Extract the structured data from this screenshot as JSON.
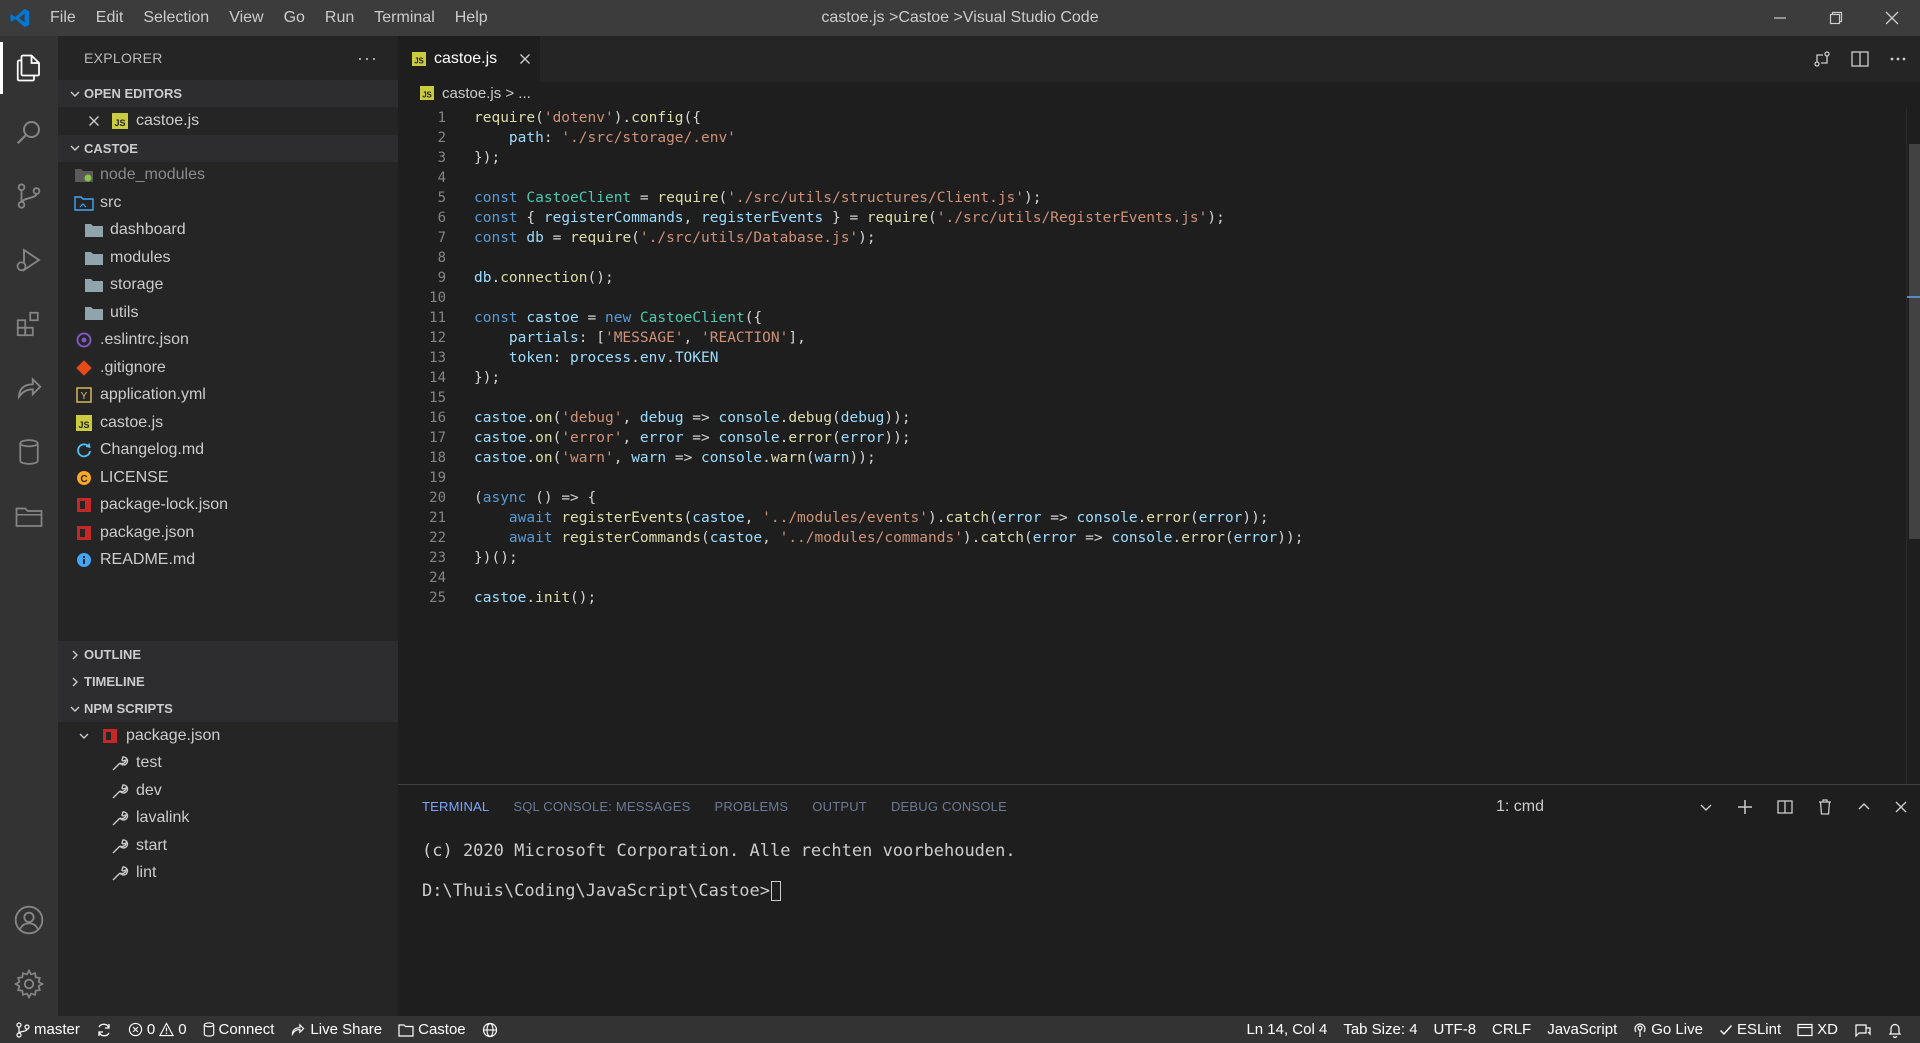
{
  "titlebar": {
    "menu": [
      "File",
      "Edit",
      "Selection",
      "View",
      "Go",
      "Run",
      "Terminal",
      "Help"
    ],
    "window_title": "castoe.js >Castoe >Visual Studio Code"
  },
  "activitybar": {
    "items": [
      "explorer-icon",
      "search-icon",
      "source-control-icon",
      "run-debug-icon",
      "extensions-icon",
      "live-share-icon",
      "database-icon",
      "project-manager-icon"
    ],
    "bottom": [
      "account-icon",
      "settings-gear-icon"
    ]
  },
  "sidebar": {
    "title": "EXPLORER",
    "more": "···",
    "open_editors_label": "OPEN EDITORS",
    "open_editors": [
      {
        "name": "castoe.js"
      }
    ],
    "project_label": "CASTOE",
    "tree": [
      {
        "name": "node_modules"
      },
      {
        "name": "src"
      },
      {
        "name": "dashboard"
      },
      {
        "name": "modules"
      },
      {
        "name": "storage"
      },
      {
        "name": "utils"
      },
      {
        "name": ".eslintrc.json"
      },
      {
        "name": ".gitignore"
      },
      {
        "name": "application.yml"
      },
      {
        "name": "castoe.js"
      },
      {
        "name": "Changelog.md"
      },
      {
        "name": "LICENSE"
      },
      {
        "name": "package-lock.json"
      },
      {
        "name": "package.json"
      },
      {
        "name": "README.md"
      }
    ],
    "outline_label": "OUTLINE",
    "timeline_label": "TIMELINE",
    "npm_label": "NPM SCRIPTS",
    "npm_package": "package.json",
    "npm_scripts": [
      "test",
      "dev",
      "lavalink",
      "start",
      "lint"
    ]
  },
  "editor": {
    "tab_label": "castoe.js",
    "breadcrumb_file": "castoe.js",
    "breadcrumb_rest": " > ...",
    "code_lines": [
      "require('dotenv').config({",
      "    path: './src/storage/.env'",
      "});",
      "",
      "const CastoeClient = require('./src/utils/structures/Client.js');",
      "const { registerCommands, registerEvents } = require('./src/utils/RegisterEvents.js');",
      "const db = require('./src/utils/Database.js');",
      "",
      "db.connection();",
      "",
      "const castoe = new CastoeClient({",
      "    partials: ['MESSAGE', 'REACTION'],",
      "    token: process.env.TOKEN",
      "});",
      "",
      "castoe.on('debug', debug => console.debug(debug));",
      "castoe.on('error', error => console.error(error));",
      "castoe.on('warn', warn => console.warn(warn));",
      "",
      "(async () => {",
      "    await registerEvents(castoe, '../modules/events').catch(error => console.error(error));",
      "    await registerCommands(castoe, '../modules/commands').catch(error => console.error(error));",
      "})();",
      "",
      "castoe.init();"
    ]
  },
  "panel": {
    "tabs": [
      "TERMINAL",
      "SQL CONSOLE: MESSAGES",
      "PROBLEMS",
      "OUTPUT",
      "DEBUG CONSOLE"
    ],
    "terminal_select": "1: cmd",
    "terminal_lines": [
      "(c) 2020 Microsoft Corporation. Alle rechten voorbehouden.",
      "D:\\Thuis\\Coding\\JavaScript\\Castoe>"
    ]
  },
  "statusbar": {
    "branch": "master",
    "errors": "0",
    "warnings": "0",
    "connect": "Connect",
    "live_share": "Live Share",
    "project": "Castoe",
    "position": "Ln 14, Col 4",
    "tab_size": "Tab Size: 4",
    "encoding": "UTF-8",
    "eol": "CRLF",
    "language": "JavaScript",
    "go_live": "Go Live",
    "eslint": "ESLint",
    "xd": "XD"
  },
  "colors": {
    "accent": "#0078d4",
    "activitybar": "#333333",
    "sidebar": "#252526",
    "editor": "#1e1e1e",
    "keyword": "#569cd6",
    "string": "#ce9178",
    "function": "#dcdcaa",
    "class": "#4ec9b0",
    "variable": "#9cdcfe"
  }
}
